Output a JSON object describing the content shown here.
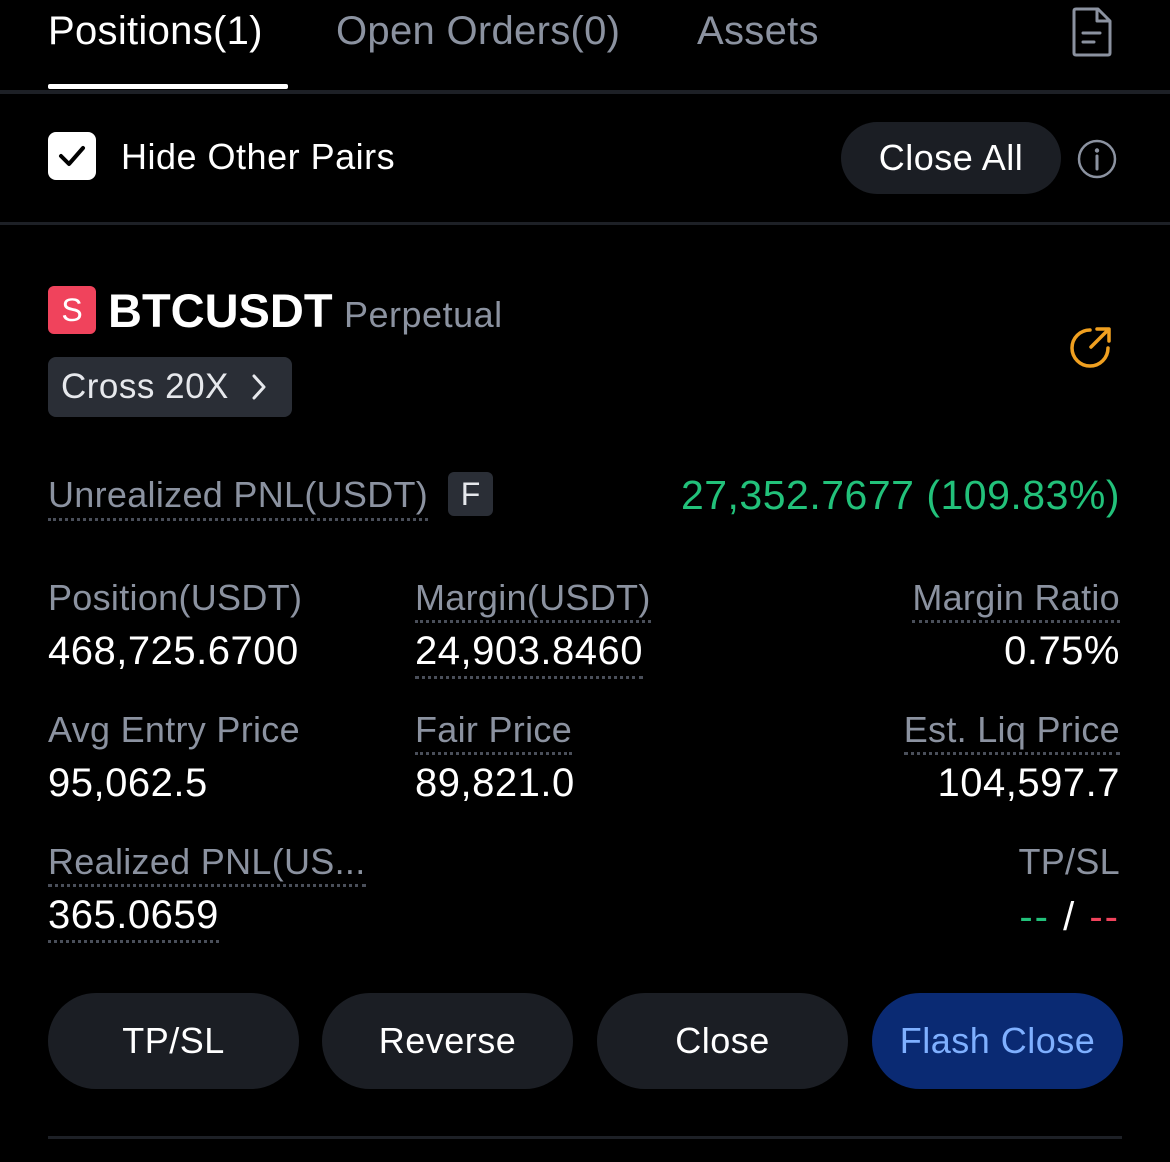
{
  "tabs": [
    {
      "label": "Positions(1)",
      "active": true
    },
    {
      "label": "Open Orders(0)",
      "active": false
    },
    {
      "label": "Assets",
      "active": false
    }
  ],
  "filter": {
    "hide_other_pairs_label": "Hide Other Pairs",
    "hide_other_pairs_checked": true,
    "close_all_label": "Close All"
  },
  "position": {
    "side_badge": "S",
    "symbol": "BTCUSDT",
    "contract_type": "Perpetual",
    "leverage": "Cross 20X",
    "unrealized_pnl_label": "Unrealized PNL(USDT)",
    "unrealized_pnl_badge": "F",
    "unrealized_pnl_value": "27,352.7677 (109.83%)",
    "stats": {
      "position_label": "Position(USDT)",
      "position_value": "468,725.6700",
      "margin_label": "Margin(USDT)",
      "margin_value": "24,903.8460",
      "margin_ratio_label": "Margin Ratio",
      "margin_ratio_value": "0.75%",
      "avg_entry_label": "Avg Entry Price",
      "avg_entry_value": "95,062.5",
      "fair_price_label": "Fair Price",
      "fair_price_value": "89,821.0",
      "liq_price_label": "Est. Liq Price",
      "liq_price_value": "104,597.7",
      "realized_pnl_label": "Realized PNL(US...",
      "realized_pnl_value": "365.0659",
      "tpsl_label": "TP/SL",
      "tp_value": "--",
      "tpsl_separator": "/",
      "sl_value": "--"
    }
  },
  "actions": {
    "tpsl": "TP/SL",
    "reverse": "Reverse",
    "close": "Close",
    "flash_close": "Flash Close"
  },
  "colors": {
    "profit": "#22c17a",
    "loss": "#f0435c",
    "accent": "#f0a020",
    "primary_button": "#0a2a73"
  },
  "icons": {
    "document": "document-icon",
    "info": "info-icon",
    "share": "share-icon",
    "chevron": "chevron-right-icon",
    "check": "check-icon"
  }
}
